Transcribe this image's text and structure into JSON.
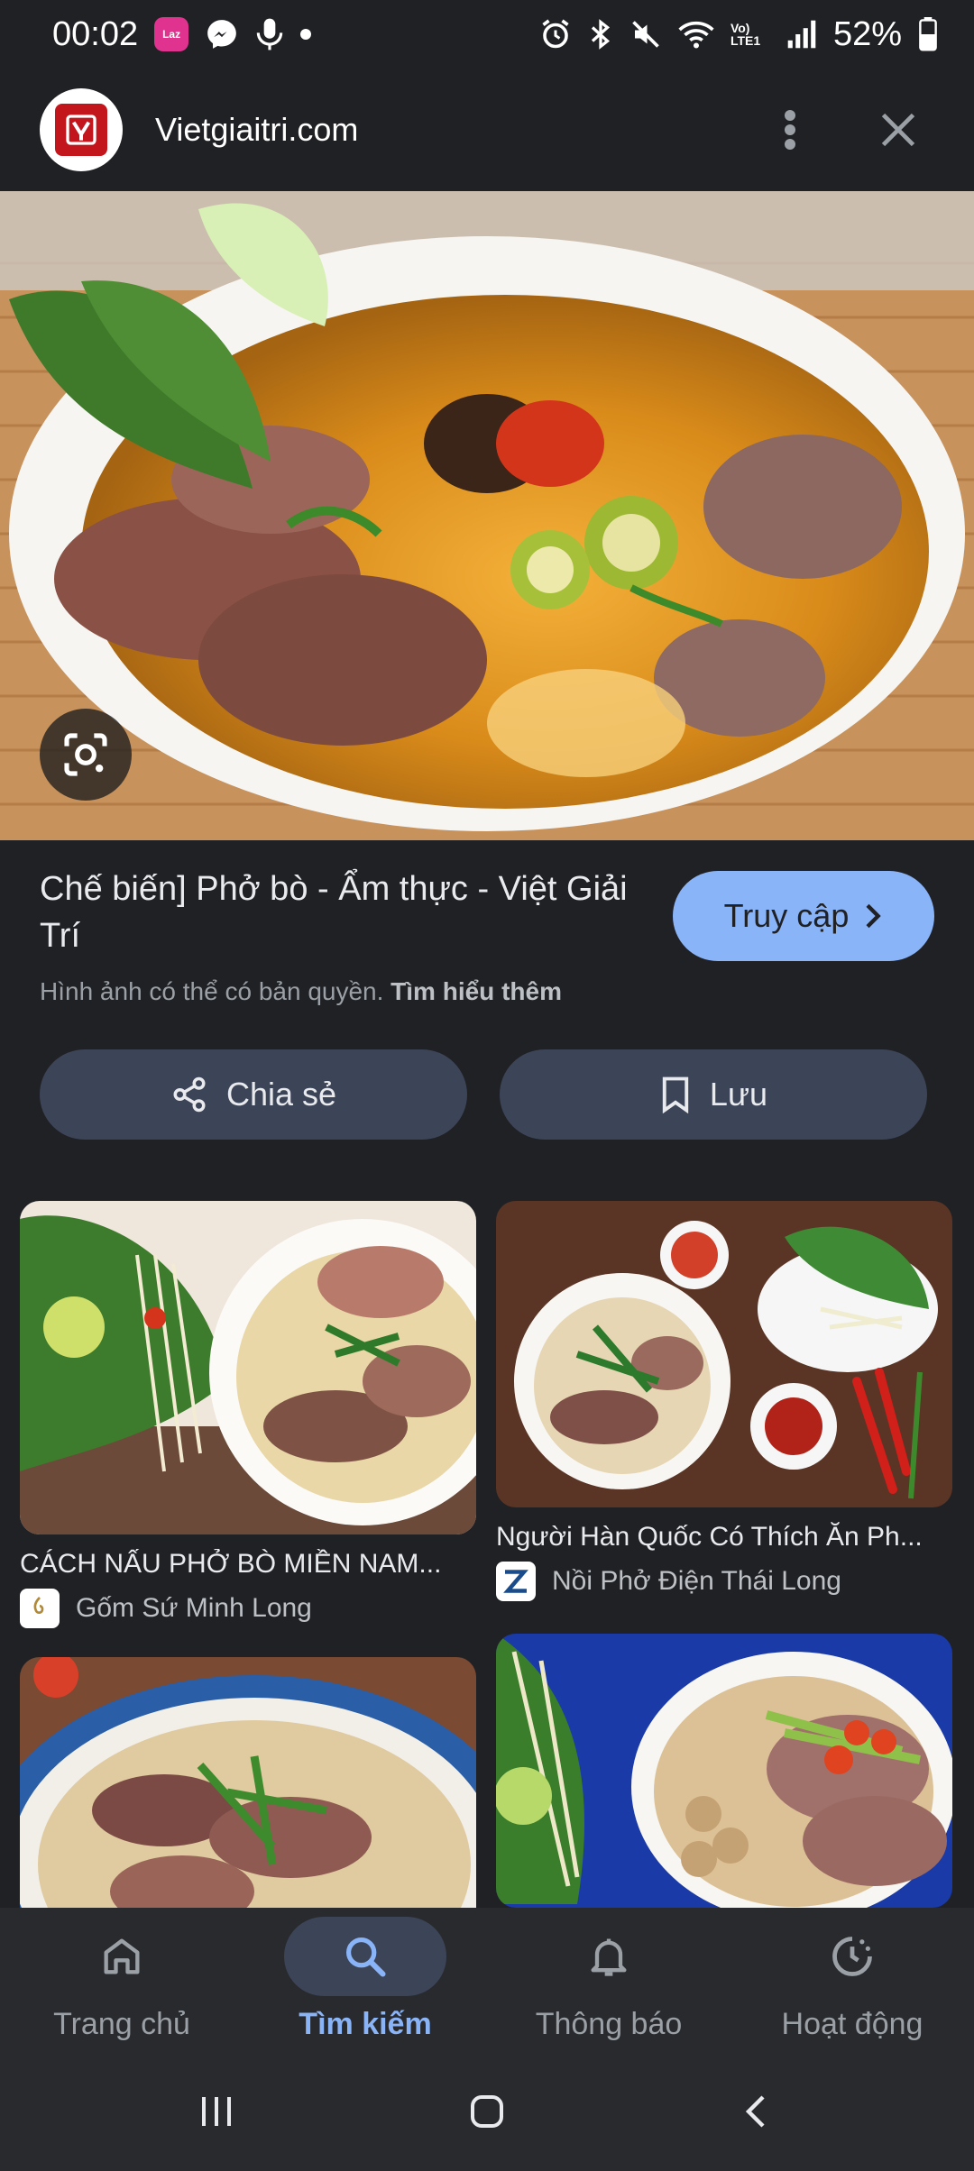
{
  "status_bar": {
    "time": "00:02",
    "battery": "52%",
    "laz_text": "Laz",
    "network": "Vo) LTE1"
  },
  "header": {
    "site_name": "Vietgiaitri.com"
  },
  "result": {
    "title": "Chế biến] Phở bò - Ẩm thực - Việt Giải Trí",
    "copyright_text": "Hình ảnh có thể có bản quyền.",
    "learn_more": "Tìm hiểu thêm",
    "visit_label": "Truy cập"
  },
  "actions": {
    "share_label": "Chia sẻ",
    "save_label": "Lưu"
  },
  "related": [
    {
      "title": "CÁCH NẤU PHỞ BÒ MIỀN NAM...",
      "source": "Gốm Sứ Minh Long"
    },
    {
      "title": "Người Hàn Quốc Có Thích Ăn Ph...",
      "source": "Nồi Phở Điện Thái Long"
    }
  ],
  "bottom_nav": [
    {
      "label": "Trang chủ",
      "icon": "home-icon",
      "active": false
    },
    {
      "label": "Tìm kiếm",
      "icon": "search-icon",
      "active": true
    },
    {
      "label": "Thông báo",
      "icon": "bell-icon",
      "active": false
    },
    {
      "label": "Hoạt động",
      "icon": "history-icon",
      "active": false
    }
  ],
  "colors": {
    "background": "#202124",
    "accent": "#8ab4f8",
    "chip": "#3c4458"
  }
}
